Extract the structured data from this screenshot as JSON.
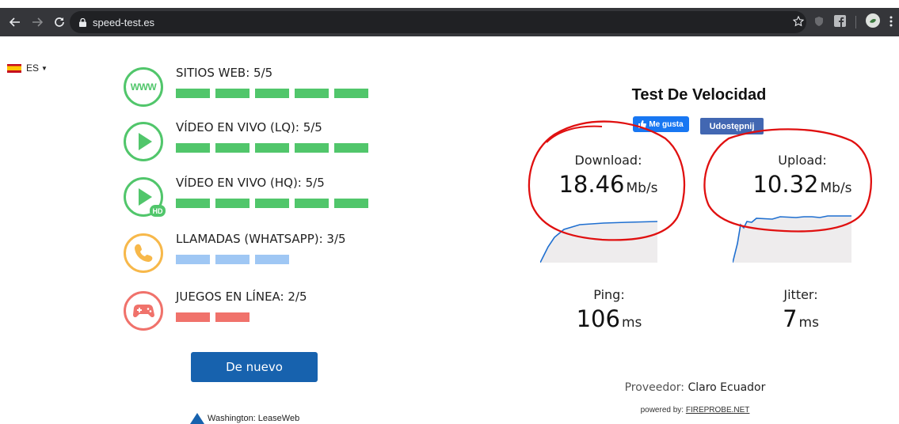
{
  "browser": {
    "url": "speed-test.es"
  },
  "language": {
    "code": "ES"
  },
  "ratings": [
    {
      "label": "SITIOS WEB: 5/5",
      "score": 5,
      "max": 5,
      "color": "#51c66b",
      "icon": "www-icon",
      "icon_text": "WWW"
    },
    {
      "label": "VÍDEO EN VIVO (LQ): 5/5",
      "score": 5,
      "max": 5,
      "color": "#51c66b",
      "icon": "play-icon"
    },
    {
      "label": "VÍDEO EN VIVO (HQ): 5/5",
      "score": 5,
      "max": 5,
      "color": "#51c66b",
      "icon": "play-hd-icon",
      "badge": "HD"
    },
    {
      "label": "LLAMADAS (WHATSAPP): 3/5",
      "score": 3,
      "max": 5,
      "color": "#9fc7f4",
      "icon": "phone-icon",
      "ring_color": "#f7b84a"
    },
    {
      "label": "JUEGOS EN LÍNEA: 2/5",
      "score": 2,
      "max": 5,
      "color": "#f0726b",
      "icon": "gamepad-icon"
    }
  ],
  "again_button": "De nuevo",
  "server": "Washington: LeaseWeb",
  "title": "Test De Velocidad",
  "facebook": {
    "like": "Me gusta",
    "share": "Udostępnij"
  },
  "download": {
    "label": "Download:",
    "value": "18.46",
    "unit": "Mb/s"
  },
  "upload": {
    "label": "Upload:",
    "value": "10.32",
    "unit": "Mb/s"
  },
  "ping": {
    "label": "Ping:",
    "value": "106",
    "unit": "ms"
  },
  "jitter": {
    "label": "Jitter:",
    "value": "7",
    "unit": "ms"
  },
  "provider": {
    "label": "Proveedor:",
    "name": "Claro Ecuador"
  },
  "powered": {
    "label": "powered by:",
    "link": "FIREPROBE.NET"
  },
  "colors": {
    "accent_button": "#1762ae",
    "graph_line": "#1f6fd0",
    "annotation_red": "#e01010"
  }
}
